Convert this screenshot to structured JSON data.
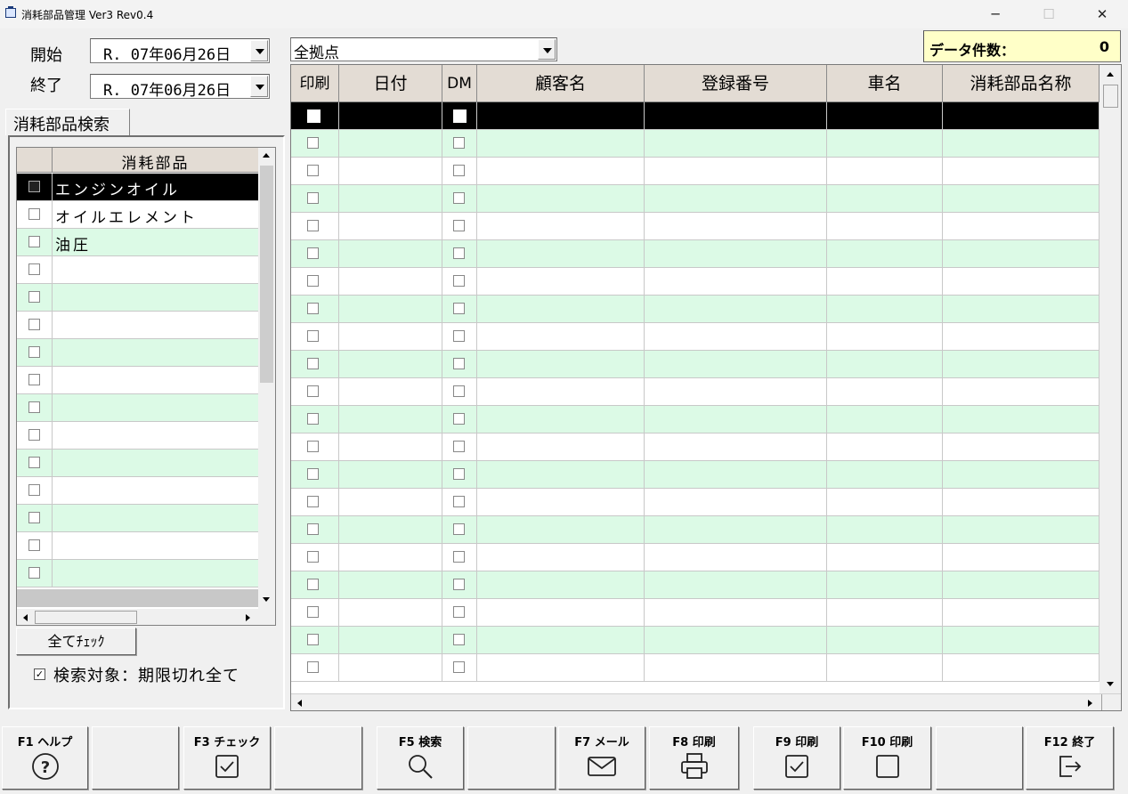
{
  "window": {
    "title": "消耗部品管理 Ver3 Rev0.4",
    "minimize": "─",
    "maximize": "☐",
    "close": "✕"
  },
  "dates": {
    "start_label": "開始",
    "start_value": "R. 07年06月26日",
    "end_label": "終了",
    "end_value": "R. 07年06月26日"
  },
  "location": {
    "selected": "全拠点"
  },
  "data_count": {
    "label": "データ件数：",
    "value": "0"
  },
  "search_panel": {
    "tab_label": "消耗部品検索",
    "column_header": "消耗部品",
    "items": [
      {
        "label": "エンジンオイル",
        "selected": true
      },
      {
        "label": "オイルエレメント",
        "selected": false
      },
      {
        "label": "油圧",
        "selected": false
      },
      {
        "label": "",
        "selected": false
      },
      {
        "label": "",
        "selected": false
      },
      {
        "label": "",
        "selected": false
      },
      {
        "label": "",
        "selected": false
      },
      {
        "label": "",
        "selected": false
      },
      {
        "label": "",
        "selected": false
      },
      {
        "label": "",
        "selected": false
      },
      {
        "label": "",
        "selected": false
      },
      {
        "label": "",
        "selected": false
      },
      {
        "label": "",
        "selected": false
      },
      {
        "label": "",
        "selected": false
      },
      {
        "label": "",
        "selected": false
      }
    ],
    "check_all_label": "全てﾁｪｯｸ",
    "search_target_label": "検索対象：期限切れ全て",
    "search_target_checked": true
  },
  "grid": {
    "columns": [
      "印刷",
      "日付",
      "DM",
      "顧客名",
      "登録番号",
      "車名",
      "消耗部品名称"
    ],
    "row_count": 21
  },
  "function_keys": [
    {
      "label": "F1 ヘルプ",
      "icon": "help-icon"
    },
    {
      "label": "",
      "icon": ""
    },
    {
      "label": "F3 チェック",
      "icon": "checkbox-checked-icon"
    },
    {
      "label": "",
      "icon": ""
    },
    {
      "label": "F5 検索",
      "icon": "search-icon"
    },
    {
      "label": "",
      "icon": ""
    },
    {
      "label": "F7 メール",
      "icon": "mail-icon"
    },
    {
      "label": "F8 印刷",
      "icon": "printer-icon"
    },
    {
      "label": "F9 印刷",
      "icon": "checkbox-checked-icon"
    },
    {
      "label": "F10 印刷",
      "icon": "checkbox-empty-icon"
    },
    {
      "label": "",
      "icon": ""
    },
    {
      "label": "F12 終了",
      "icon": "exit-icon"
    }
  ],
  "colors": {
    "row_alt": "#dcfae6",
    "selected_row": "#000000",
    "header_bg": "#e3dcd4",
    "count_bg": "#ffffc8"
  }
}
